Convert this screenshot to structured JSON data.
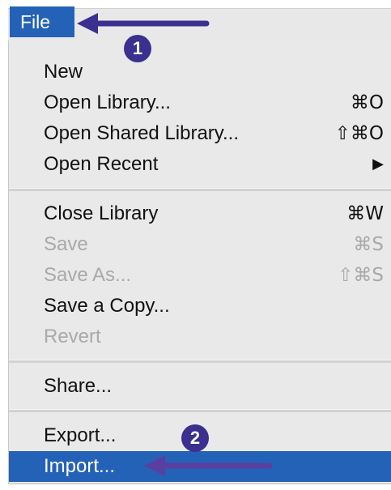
{
  "menu": {
    "title": "File",
    "items": [
      {
        "label": "New",
        "shortcut": "",
        "enabled": true
      },
      {
        "label": "Open Library...",
        "shortcut": "⌘O",
        "enabled": true
      },
      {
        "label": "Open Shared Library...",
        "shortcut": "⇧⌘O",
        "enabled": true
      },
      {
        "label": "Open Recent",
        "shortcut": "▶",
        "enabled": true
      },
      {
        "label": "Close Library",
        "shortcut": "⌘W",
        "enabled": true
      },
      {
        "label": "Save",
        "shortcut": "⌘S",
        "enabled": false
      },
      {
        "label": "Save As...",
        "shortcut": "⇧⌘S",
        "enabled": false
      },
      {
        "label": "Save a Copy...",
        "shortcut": "",
        "enabled": true
      },
      {
        "label": "Revert",
        "shortcut": "",
        "enabled": false
      },
      {
        "label": "Share...",
        "shortcut": "",
        "enabled": true
      },
      {
        "label": "Export...",
        "shortcut": "",
        "enabled": true
      },
      {
        "label": "Import...",
        "shortcut": "",
        "enabled": true,
        "highlighted": true
      }
    ]
  },
  "annotations": {
    "step1": "1",
    "step2": "2",
    "color": "#3b2f8f"
  },
  "colors": {
    "highlight": "#2462b8",
    "menu_background": "#e9e9e9",
    "disabled_text": "#a9a9a9"
  }
}
